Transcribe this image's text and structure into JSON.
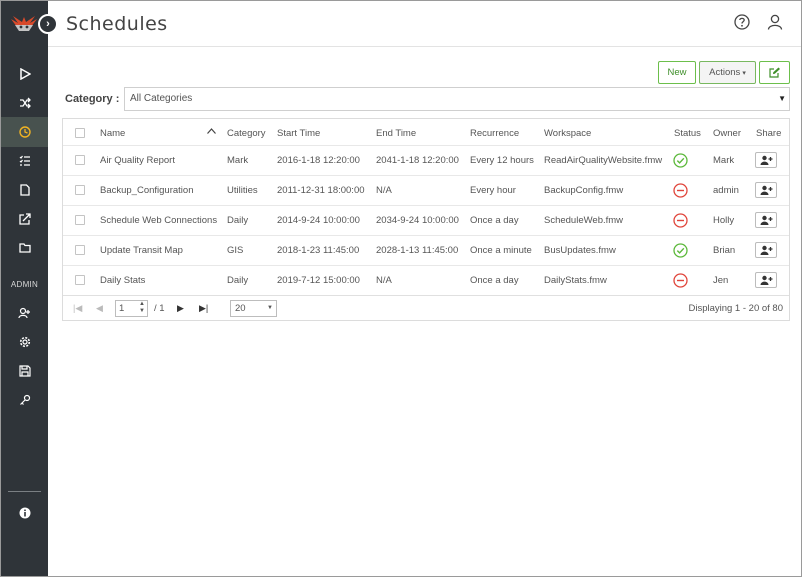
{
  "header": {
    "title": "Schedules"
  },
  "sidebar": {
    "admin_label": "ADMIN",
    "items": [
      {
        "icon": "play-icon"
      },
      {
        "icon": "shuffle-icon"
      },
      {
        "icon": "clock-icon",
        "active": true
      },
      {
        "icon": "list-check-icon"
      },
      {
        "icon": "file-icon"
      },
      {
        "icon": "share-export-icon"
      },
      {
        "icon": "folder-icon"
      },
      {
        "icon": "add-user-icon"
      },
      {
        "icon": "gear-icon"
      },
      {
        "icon": "save-icon"
      },
      {
        "icon": "key-icon"
      },
      {
        "icon": "info-icon"
      }
    ]
  },
  "toolbar": {
    "new_label": "New",
    "actions_label": "Actions",
    "accent_color": "#6cbf4b"
  },
  "filter": {
    "category_label": "Category :",
    "category_value": "All Categories"
  },
  "table": {
    "columns": [
      "Name",
      "Category",
      "Start Time",
      "End Time",
      "Recurrence",
      "Workspace",
      "Status",
      "Owner",
      "Share"
    ],
    "sort_column": "Name",
    "rows": [
      {
        "name": "Air Quality Report",
        "category": "Mark",
        "start": "2016-1-18 12:20:00",
        "end": "2041-1-18 12:20:00",
        "recurrence": "Every 12 hours",
        "workspace": "ReadAirQualityWebsite.fmw",
        "status": "enabled",
        "owner": "Mark"
      },
      {
        "name": "Backup_Configuration",
        "category": "Utilities",
        "start": "2011-12-31 18:00:00",
        "end": "N/A",
        "recurrence": "Every hour",
        "workspace": "BackupConfig.fmw",
        "status": "disabled",
        "owner": "admin"
      },
      {
        "name": "Schedule Web Connections",
        "category": "Daily",
        "start": "2014-9-24 10:00:00",
        "end": "2034-9-24 10:00:00",
        "recurrence": "Once a day",
        "workspace": "ScheduleWeb.fmw",
        "status": "disabled",
        "owner": "Holly"
      },
      {
        "name": "Update Transit Map",
        "category": "GIS",
        "start": "2018-1-23 11:45:00",
        "end": "2028-1-13 11:45:00",
        "recurrence": "Once a minute",
        "workspace": "BusUpdates.fmw",
        "status": "enabled",
        "owner": "Brian"
      },
      {
        "name": "Daily Stats",
        "category": "Daily",
        "start": "2019-7-12 15:00:00",
        "end": "N/A",
        "recurrence": "Once a day",
        "workspace": "DailyStats.fmw",
        "status": "disabled",
        "owner": "Jen"
      }
    ]
  },
  "pager": {
    "page": "1",
    "total_pages": "/ 1",
    "page_size": "20",
    "display_text": "Displaying 1 - 20 of 80"
  },
  "colors": {
    "enabled": "#5bb83a",
    "disabled": "#e0443a",
    "sidebar": "#2f3439"
  }
}
